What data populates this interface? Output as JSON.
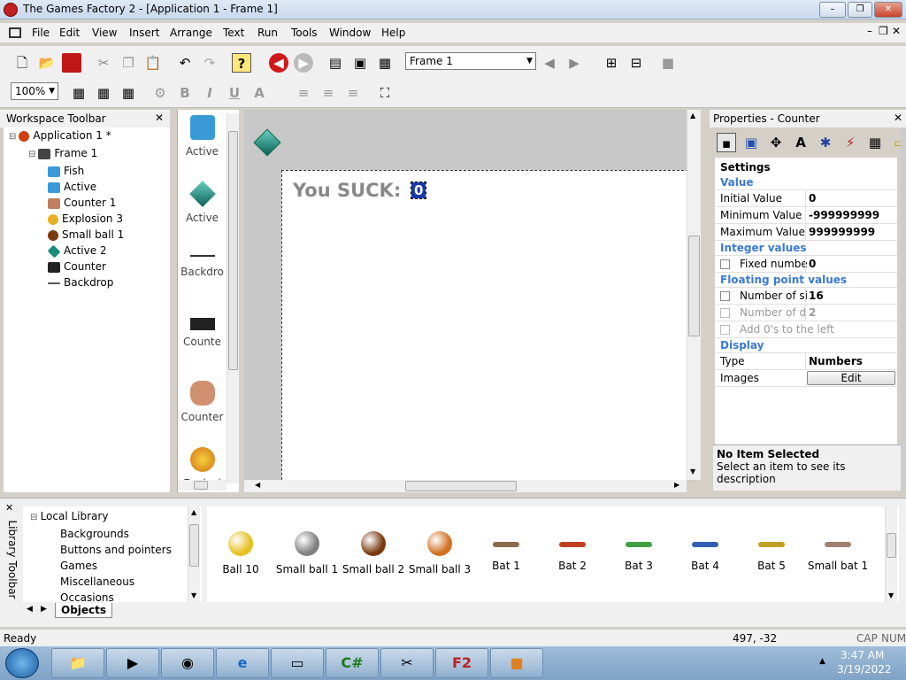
{
  "window": {
    "title": "The Games Factory 2 - [Application 1 - Frame 1]",
    "min": "–",
    "max": "❐",
    "close": "✕"
  },
  "menu": [
    "File",
    "Edit",
    "View",
    "Insert",
    "Arrange",
    "Text",
    "Run",
    "Tools",
    "Window",
    "Help"
  ],
  "toolbar": {
    "frame_select": "Frame 1",
    "zoom": "100%"
  },
  "workspace": {
    "title": "Workspace Toolbar",
    "tree": [
      {
        "label": "Application 1 *",
        "level": 0,
        "icon": "app"
      },
      {
        "label": "Frame 1",
        "level": 1,
        "icon": "frame"
      },
      {
        "label": "Fish",
        "level": 2,
        "icon": "fish"
      },
      {
        "label": "Active",
        "level": 2,
        "icon": "fish"
      },
      {
        "label": "Counter 1",
        "level": 2,
        "icon": "pig"
      },
      {
        "label": "Explosion 3",
        "level": 2,
        "icon": "explosion"
      },
      {
        "label": "Small ball 1",
        "level": 2,
        "icon": "ball"
      },
      {
        "label": "Active 2",
        "level": 2,
        "icon": "diamond"
      },
      {
        "label": "Counter",
        "level": 2,
        "icon": "counter"
      },
      {
        "label": "Backdrop",
        "level": 2,
        "icon": "backdrop"
      }
    ]
  },
  "objects_strip": [
    "Active",
    "Active",
    "Backdro",
    "Counte",
    "Counter",
    "Explosi"
  ],
  "editor": {
    "text_label": "You SUCK:",
    "counter_value": "0"
  },
  "properties": {
    "title": "Properties - Counter",
    "settings": "Settings",
    "cat_value": "Value",
    "initial_label": "Initial Value",
    "initial": "0",
    "min_label": "Minimum Value",
    "min": "-999999999",
    "max_label": "Maximum Value",
    "max": "999999999",
    "cat_integer": "Integer values",
    "fixed_label": "Fixed numbe",
    "fixed": "0",
    "cat_float": "Floating point values",
    "sig_label": "Number of si",
    "sig": "16",
    "dec_label": "Number of d",
    "dec": "2",
    "zeros_label": "Add 0's to the left",
    "cat_display": "Display",
    "type_label": "Type",
    "type": "Numbers",
    "images_label": "Images",
    "edit_btn": "Edit",
    "desc_title": "No Item Selected",
    "desc_text": "Select an item to see its description"
  },
  "library": {
    "title": "Library Toolbar",
    "tree": [
      "Local Library",
      "Backgrounds",
      "Buttons and pointers",
      "Games",
      "Miscellaneous",
      "Occasions"
    ],
    "tab": "Objects",
    "items": [
      {
        "label": "Ball 10",
        "color": "#e8c020"
      },
      {
        "label": "Small ball 1",
        "color": "#808080"
      },
      {
        "label": "Small ball 2",
        "color": "#7a3a10"
      },
      {
        "label": "Small ball 3",
        "color": "#d07020"
      },
      {
        "label": "Bat 1",
        "color": "#8a6a4a"
      },
      {
        "label": "Bat 2",
        "color": "#c04020"
      },
      {
        "label": "Bat 3",
        "color": "#40a040"
      },
      {
        "label": "Bat 4",
        "color": "#3060b0"
      },
      {
        "label": "Bat 5",
        "color": "#c0a020"
      },
      {
        "label": "Small bat 1",
        "color": "#a08070"
      }
    ]
  },
  "status": {
    "text": "Ready",
    "coords": "497, -32",
    "cap": "CAP",
    "num": "NUM"
  },
  "clock": {
    "time": "3:47 AM",
    "date": "3/19/2022"
  }
}
